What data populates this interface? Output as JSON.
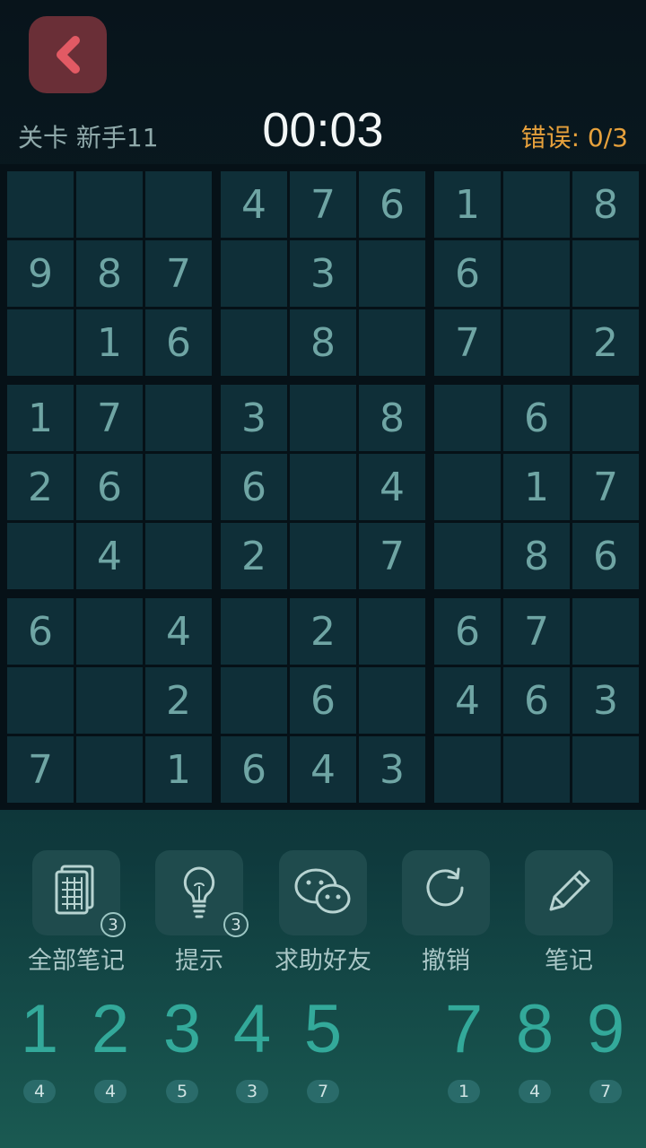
{
  "header": {
    "level_label": "关卡 新手11",
    "timer": "00:03",
    "errors_label": "错误: 0/3"
  },
  "colors": {
    "accent": "#33a99a",
    "back_button": "#6a2f37",
    "errors": "#e7a13c",
    "cell": "#0f2f38"
  },
  "board": [
    [
      "",
      "",
      "",
      "4",
      "7",
      "6",
      "1",
      "",
      "8"
    ],
    [
      "9",
      "8",
      "7",
      "",
      "3",
      "",
      "6",
      "",
      ""
    ],
    [
      "",
      "1",
      "6",
      "",
      "8",
      "",
      "7",
      "",
      "2"
    ],
    [
      "1",
      "7",
      "",
      "3",
      "",
      "8",
      "",
      "6",
      ""
    ],
    [
      "2",
      "6",
      "",
      "6",
      "",
      "4",
      "",
      "1",
      "7"
    ],
    [
      "",
      "4",
      "",
      "2",
      "",
      "7",
      "",
      "8",
      "6"
    ],
    [
      "6",
      "",
      "4",
      "",
      "2",
      "",
      "6",
      "7",
      ""
    ],
    [
      "",
      "",
      "2",
      "",
      "6",
      "",
      "4",
      "6",
      "3"
    ],
    [
      "7",
      "",
      "1",
      "6",
      "4",
      "3",
      "",
      "",
      ""
    ]
  ],
  "tools": [
    {
      "icon": "all-notes-icon",
      "label": "全部笔记",
      "badge": "3"
    },
    {
      "icon": "lightbulb-icon",
      "label": "提示",
      "badge": "3"
    },
    {
      "icon": "wechat-icon",
      "label": "求助好友",
      "badge": ""
    },
    {
      "icon": "undo-icon",
      "label": "撤销",
      "badge": ""
    },
    {
      "icon": "pencil-icon",
      "label": "笔记",
      "badge": ""
    }
  ],
  "numpad": [
    {
      "digit": "1",
      "count": "4"
    },
    {
      "digit": "2",
      "count": "4"
    },
    {
      "digit": "3",
      "count": "5"
    },
    {
      "digit": "4",
      "count": "3"
    },
    {
      "digit": "5",
      "count": "7"
    },
    {
      "digit": "",
      "count": ""
    },
    {
      "digit": "7",
      "count": "1"
    },
    {
      "digit": "8",
      "count": "4"
    },
    {
      "digit": "9",
      "count": "7"
    }
  ]
}
